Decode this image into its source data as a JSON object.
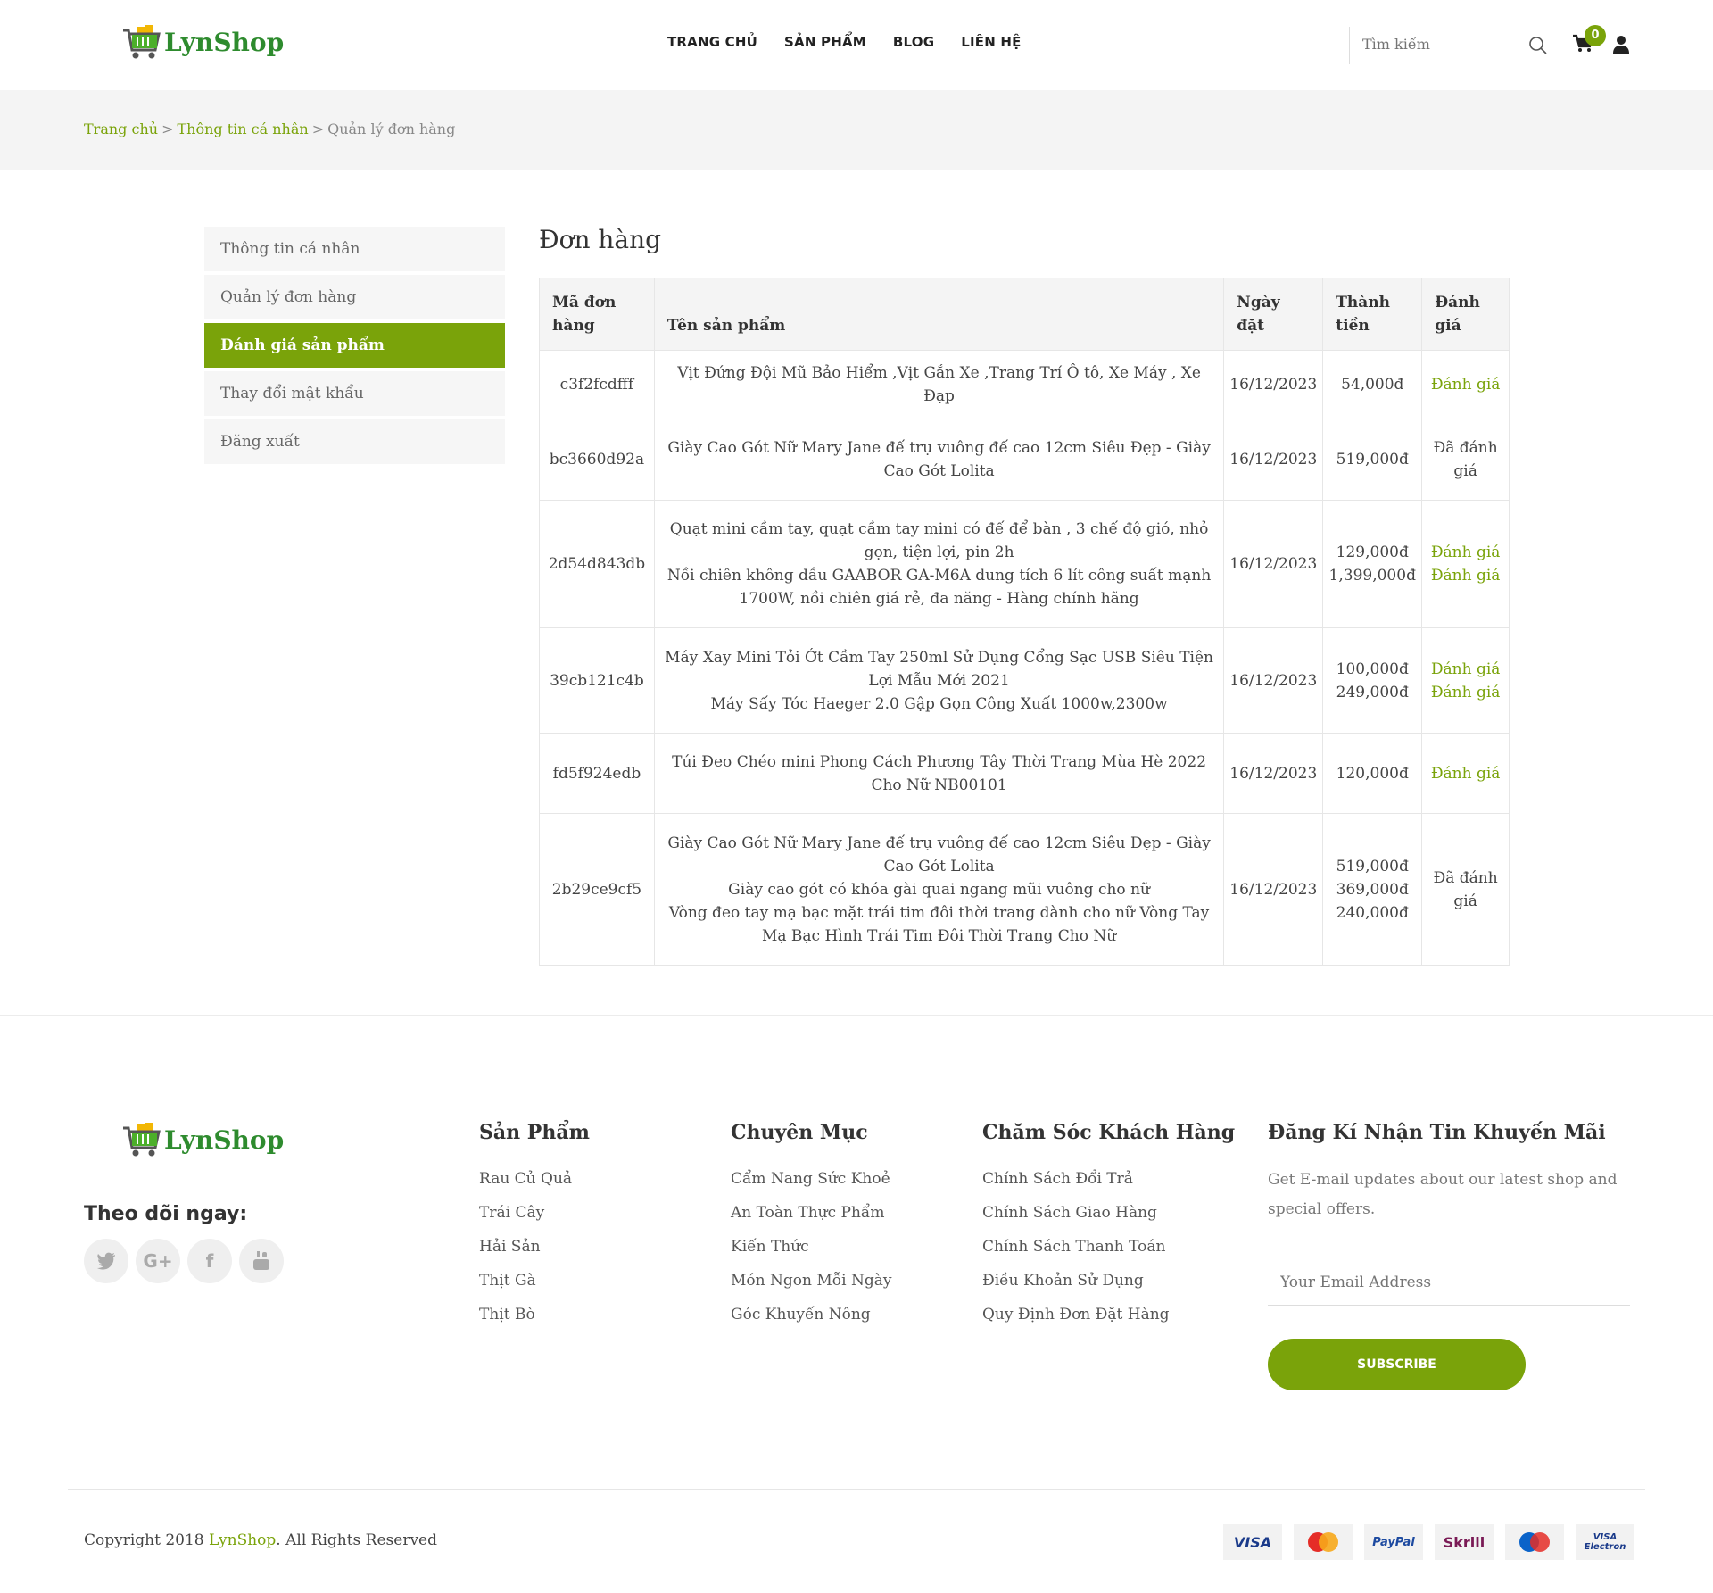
{
  "brand": {
    "name": "LynShop"
  },
  "nav": {
    "items": [
      "TRANG CHỦ",
      "SẢN PHẨM",
      "BLOG",
      "LIÊN HỆ"
    ],
    "search_placeholder": "Tìm kiếm",
    "cart_count": "0"
  },
  "breadcrumb": {
    "home": "Trang chủ",
    "profile": "Thông tin cá nhân",
    "current": "Quản lý đơn hàng",
    "sep": ">"
  },
  "sidebar": {
    "items": [
      {
        "label": "Thông tin cá nhân",
        "active": false
      },
      {
        "label": "Quản lý đơn hàng",
        "active": false
      },
      {
        "label": "Đánh giá sản phẩm",
        "active": true
      },
      {
        "label": "Thay đổi mật khẩu",
        "active": false
      },
      {
        "label": "Đăng xuất",
        "active": false
      }
    ]
  },
  "orders": {
    "title": "Đơn hàng",
    "headers": {
      "code": [
        "Mã đơn",
        "hàng"
      ],
      "product": "Tên sản phẩm",
      "date": [
        "Ngày",
        "đặt"
      ],
      "total": [
        "Thành",
        "tiền"
      ],
      "rating": [
        "Đánh",
        "giá"
      ]
    },
    "rows": [
      {
        "code": "c3f2fcdfff",
        "products": [
          "Vịt Đứng Đội Mũ Bảo Hiểm ,Vịt Gắn Xe ,Trang Trí Ô tô, Xe Máy , Xe Đạp"
        ],
        "date": "16/12/2023",
        "prices": [
          "54,000đ"
        ],
        "ratings": [
          {
            "text": "Đánh giá",
            "rated": false
          }
        ]
      },
      {
        "code": "bc3660d92a",
        "products": [
          "Giày Cao Gót Nữ Mary Jane đế trụ vuông đế cao 12cm Siêu Đẹp - Giày Cao Gót Lolita"
        ],
        "date": "16/12/2023",
        "prices": [
          "519,000đ"
        ],
        "ratings": [
          {
            "text": "Đã đánh giá",
            "rated": true
          }
        ]
      },
      {
        "code": "2d54d843db",
        "products": [
          "Quạt mini cầm tay, quạt cầm tay mini có đế để bàn , 3 chế độ gió, nhỏ gọn, tiện lợi, pin 2h",
          "Nồi chiên không dầu GAABOR GA-M6A dung tích 6 lít công suất mạnh 1700W, nồi chiên giá rẻ, đa năng - Hàng chính hãng"
        ],
        "date": "16/12/2023",
        "prices": [
          "129,000đ",
          "1,399,000đ"
        ],
        "ratings": [
          {
            "text": "Đánh giá",
            "rated": false
          },
          {
            "text": "Đánh giá",
            "rated": false
          }
        ]
      },
      {
        "code": "39cb121c4b",
        "products": [
          "Máy Xay Mini Tỏi Ớt Cầm Tay 250ml Sử Dụng Cổng Sạc USB Siêu Tiện Lợi Mẫu Mới 2021",
          "Máy Sấy Tóc Haeger 2.0 Gập Gọn Công Xuất 1000w,2300w"
        ],
        "date": "16/12/2023",
        "prices": [
          "100,000đ",
          "249,000đ"
        ],
        "ratings": [
          {
            "text": "Đánh giá",
            "rated": false
          },
          {
            "text": "Đánh giá",
            "rated": false
          }
        ]
      },
      {
        "code": "fd5f924edb",
        "products": [
          "Túi Đeo Chéo mini Phong Cách Phương Tây Thời Trang Mùa Hè 2022 Cho Nữ NB00101"
        ],
        "date": "16/12/2023",
        "prices": [
          "120,000đ"
        ],
        "ratings": [
          {
            "text": "Đánh giá",
            "rated": false
          }
        ]
      },
      {
        "code": "2b29ce9cf5",
        "products": [
          "Giày Cao Gót Nữ Mary Jane đế trụ vuông đế cao 12cm Siêu Đẹp - Giày Cao Gót Lolita",
          "Giày cao gót có khóa gài quai ngang mũi vuông cho nữ",
          "Vòng đeo tay mạ bạc mặt trái tim đôi thời trang dành cho nữ Vòng Tay Mạ Bạc Hình Trái Tim Đôi Thời Trang Cho Nữ"
        ],
        "date": "16/12/2023",
        "prices": [
          "519,000đ",
          "369,000đ",
          "240,000đ"
        ],
        "ratings": [
          {
            "text": "Đã đánh giá",
            "rated": true
          }
        ]
      }
    ]
  },
  "footer": {
    "follow_title": "Theo dõi ngay:",
    "socials": [
      "twitter-icon",
      "google-plus-icon",
      "facebook-icon",
      "youtube-icon"
    ],
    "columns": [
      {
        "title": "Sản Phẩm",
        "links": [
          "Rau Củ Quả",
          "Trái Cây",
          "Hải Sản",
          "Thịt Gà",
          "Thịt Bò"
        ]
      },
      {
        "title": "Chuyên Mục",
        "links": [
          "Cẩm Nang Sức Khoẻ",
          "An Toàn Thực Phẩm",
          "Kiến Thức",
          "Món Ngon Mỗi Ngày",
          "Góc Khuyến Nông"
        ]
      },
      {
        "title": "Chăm Sóc Khách Hàng",
        "links": [
          "Chính Sách Đổi Trả",
          "Chính Sách Giao Hàng",
          "Chính Sách Thanh Toán",
          "Điều Khoản Sử Dụng",
          "Quy Định Đơn Đặt Hàng"
        ]
      }
    ],
    "newsletter": {
      "title": "Đăng Kí Nhận Tin Khuyến Mãi",
      "desc": "Get E-mail updates about our latest shop and special offers.",
      "placeholder": "Your Email Address",
      "button": "SUBSCRIBE"
    },
    "copyright_prefix": "Copyright 2018 ",
    "copyright_brand": "LynShop",
    "copyright_suffix": ". All Rights Reserved",
    "payments": [
      "VISA",
      "MasterCard",
      "PayPal",
      "Skrill",
      "Maestro",
      "VISA Electron"
    ]
  },
  "colors": {
    "accent": "#7aa30a",
    "brand_green": "#2e8b2e",
    "muted_bg": "#f4f4f4"
  }
}
